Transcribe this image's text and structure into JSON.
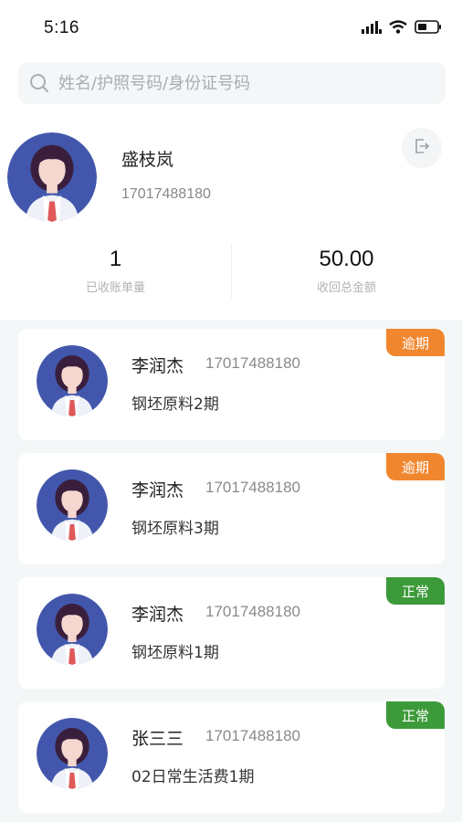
{
  "status_bar": {
    "time": "5:16"
  },
  "search": {
    "placeholder": "姓名/护照号码/身份证号码"
  },
  "user": {
    "name": "盛枝岚",
    "phone": "17017488180"
  },
  "stats": [
    {
      "value": "1",
      "label": "已收账单量"
    },
    {
      "value": "50.00",
      "label": "收回总金额"
    }
  ],
  "records": [
    {
      "name": "李润杰",
      "phone": "17017488180",
      "desc": "钢坯原料2期",
      "badge": "逾期",
      "badge_color": "#f0872f"
    },
    {
      "name": "李润杰",
      "phone": "17017488180",
      "desc": "钢坯原料3期",
      "badge": "逾期",
      "badge_color": "#f0872f"
    },
    {
      "name": "李润杰",
      "phone": "17017488180",
      "desc": "钢坯原料1期",
      "badge": "正常",
      "badge_color": "#3d9a3a"
    },
    {
      "name": "张三三",
      "phone": "17017488180",
      "desc": "02日常生活费1期",
      "badge": "正常",
      "badge_color": "#3d9a3a"
    }
  ],
  "icons": {
    "search": "search-icon",
    "logout": "logout-icon",
    "signal": "signal-icon",
    "wifi": "wifi-icon",
    "battery": "battery-icon"
  }
}
